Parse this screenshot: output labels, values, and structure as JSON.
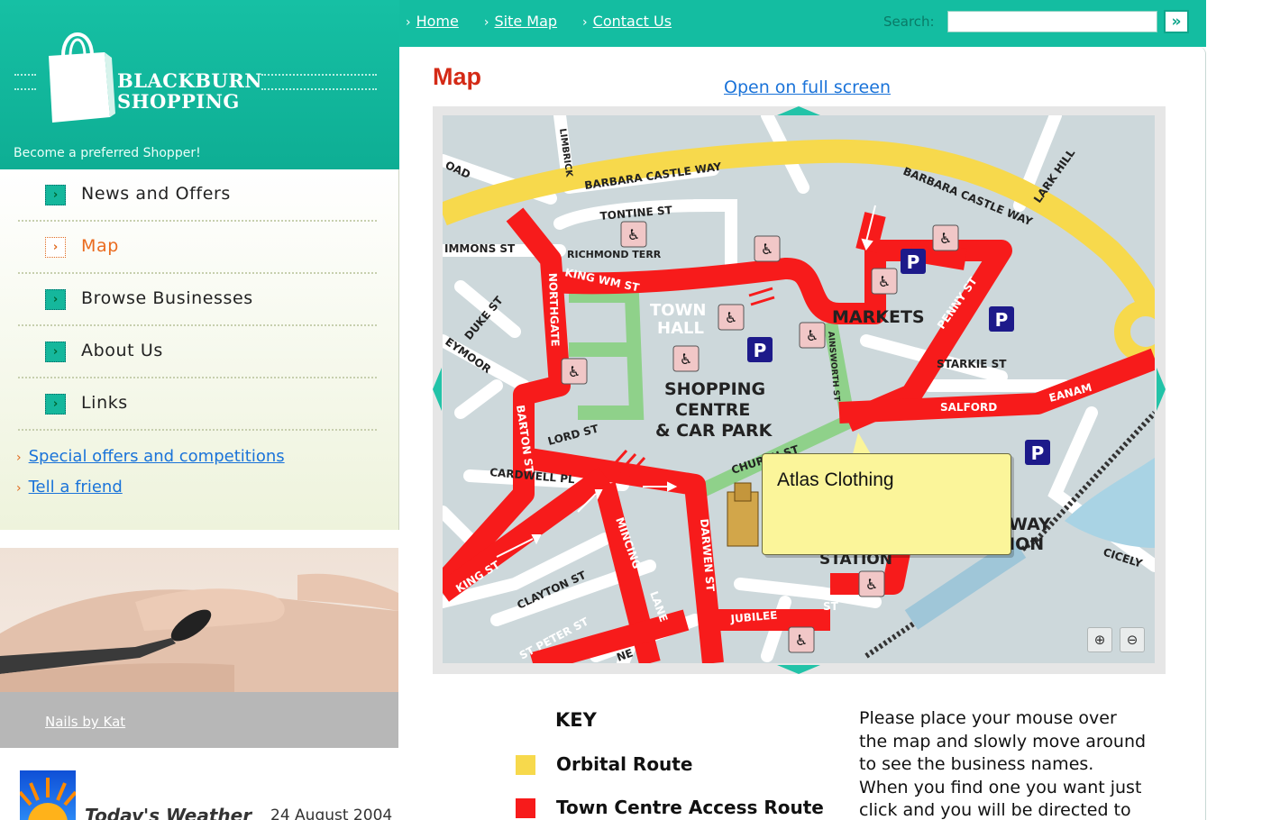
{
  "brand": {
    "name_line1": "BLACKBURN",
    "name_line2": "SHOPPING",
    "tagline": "Become a preferred Shopper!"
  },
  "topnav": [
    {
      "label": "Home"
    },
    {
      "label": "Site Map"
    },
    {
      "label": "Contact Us"
    }
  ],
  "search": {
    "label": "Search:",
    "value": "",
    "go_icon": "double-chevron-right-icon"
  },
  "sidebar": {
    "items": [
      {
        "label": "News and Offers",
        "active": false
      },
      {
        "label": "Map",
        "active": true
      },
      {
        "label": "Browse Businesses",
        "active": false
      },
      {
        "label": "About Us",
        "active": false
      },
      {
        "label": "Links",
        "active": false
      }
    ],
    "links": [
      {
        "label": "Special offers and competitions"
      },
      {
        "label": "Tell a friend"
      }
    ]
  },
  "promo": {
    "caption": "Nails by Kat"
  },
  "weather": {
    "title": "Today's Weather",
    "date": "24 August 2004"
  },
  "main": {
    "title": "Map",
    "fullscreen_link": "Open on full screen"
  },
  "map": {
    "streets": {
      "barbara_castle_way_1": "BARBARA CASTLE WAY",
      "barbara_castle_way_2": "BARBARA CASTLE WAY",
      "oad": "OAD",
      "limbrick": "LIMBRICK",
      "tontine": "TONTINE ST",
      "richmond": "RICHMOND TERR",
      "simmons": "IMMONS ST",
      "king_wm": "KING WM ST",
      "northgate": "NORTHGATE",
      "duke": "DUKE ST",
      "seymoor": "EYMOOR",
      "lark_hill": "LARK HILL",
      "penny": "PENNY ST",
      "starkie": "STARKIE ST",
      "salford": "SALFORD",
      "eanam": "EANAM",
      "ainsworth": "AINSWORTH ST",
      "lord": "LORD ST",
      "barton": "BARTON ST",
      "cardwell": "CARDWELL PL",
      "church": "CHURCH ST",
      "king": "KING ST",
      "clayton": "CLAYTON ST",
      "mincing": "MINCING",
      "lane": "LANE",
      "darwen": "DARWEN ST",
      "jubilee": "JUBILEE",
      "st": "ST",
      "st_peter": "ST PETER ST",
      "ne": "NE",
      "cicely": "CICELY",
      "way_frag": "WAY",
      "ion_frag": "ION",
      "station_frag": "STATION"
    },
    "places": {
      "town_hall_1": "TOWN",
      "town_hall_2": "HALL",
      "markets": "MARKETS",
      "shopping_1": "SHOPPING",
      "shopping_2": "CENTRE",
      "shopping_3": "& CAR PARK"
    },
    "parking_symbol": "P",
    "tooltip": "Atlas Clothing",
    "zoom_in_icon": "zoom-in-icon",
    "zoom_out_icon": "zoom-out-icon",
    "colors": {
      "background": "#cdd8db",
      "orbital": "#f7d94c",
      "access": "#f71b1b",
      "pedestrian": "#8fd18a",
      "street": "#ffffff",
      "accent": "#14bda1"
    }
  },
  "key": {
    "title": "KEY",
    "items": [
      {
        "label": "Orbital Route",
        "color": "#f7d94c"
      },
      {
        "label": "Town Centre Access Route",
        "color": "#f71b1b"
      }
    ]
  },
  "instructions": {
    "line1": "Please place your mouse over",
    "line2": "the map and slowly move around",
    "line3": "to see the business names.",
    "line4": "When you find one you want just",
    "line5": "click and you will be directed to"
  }
}
